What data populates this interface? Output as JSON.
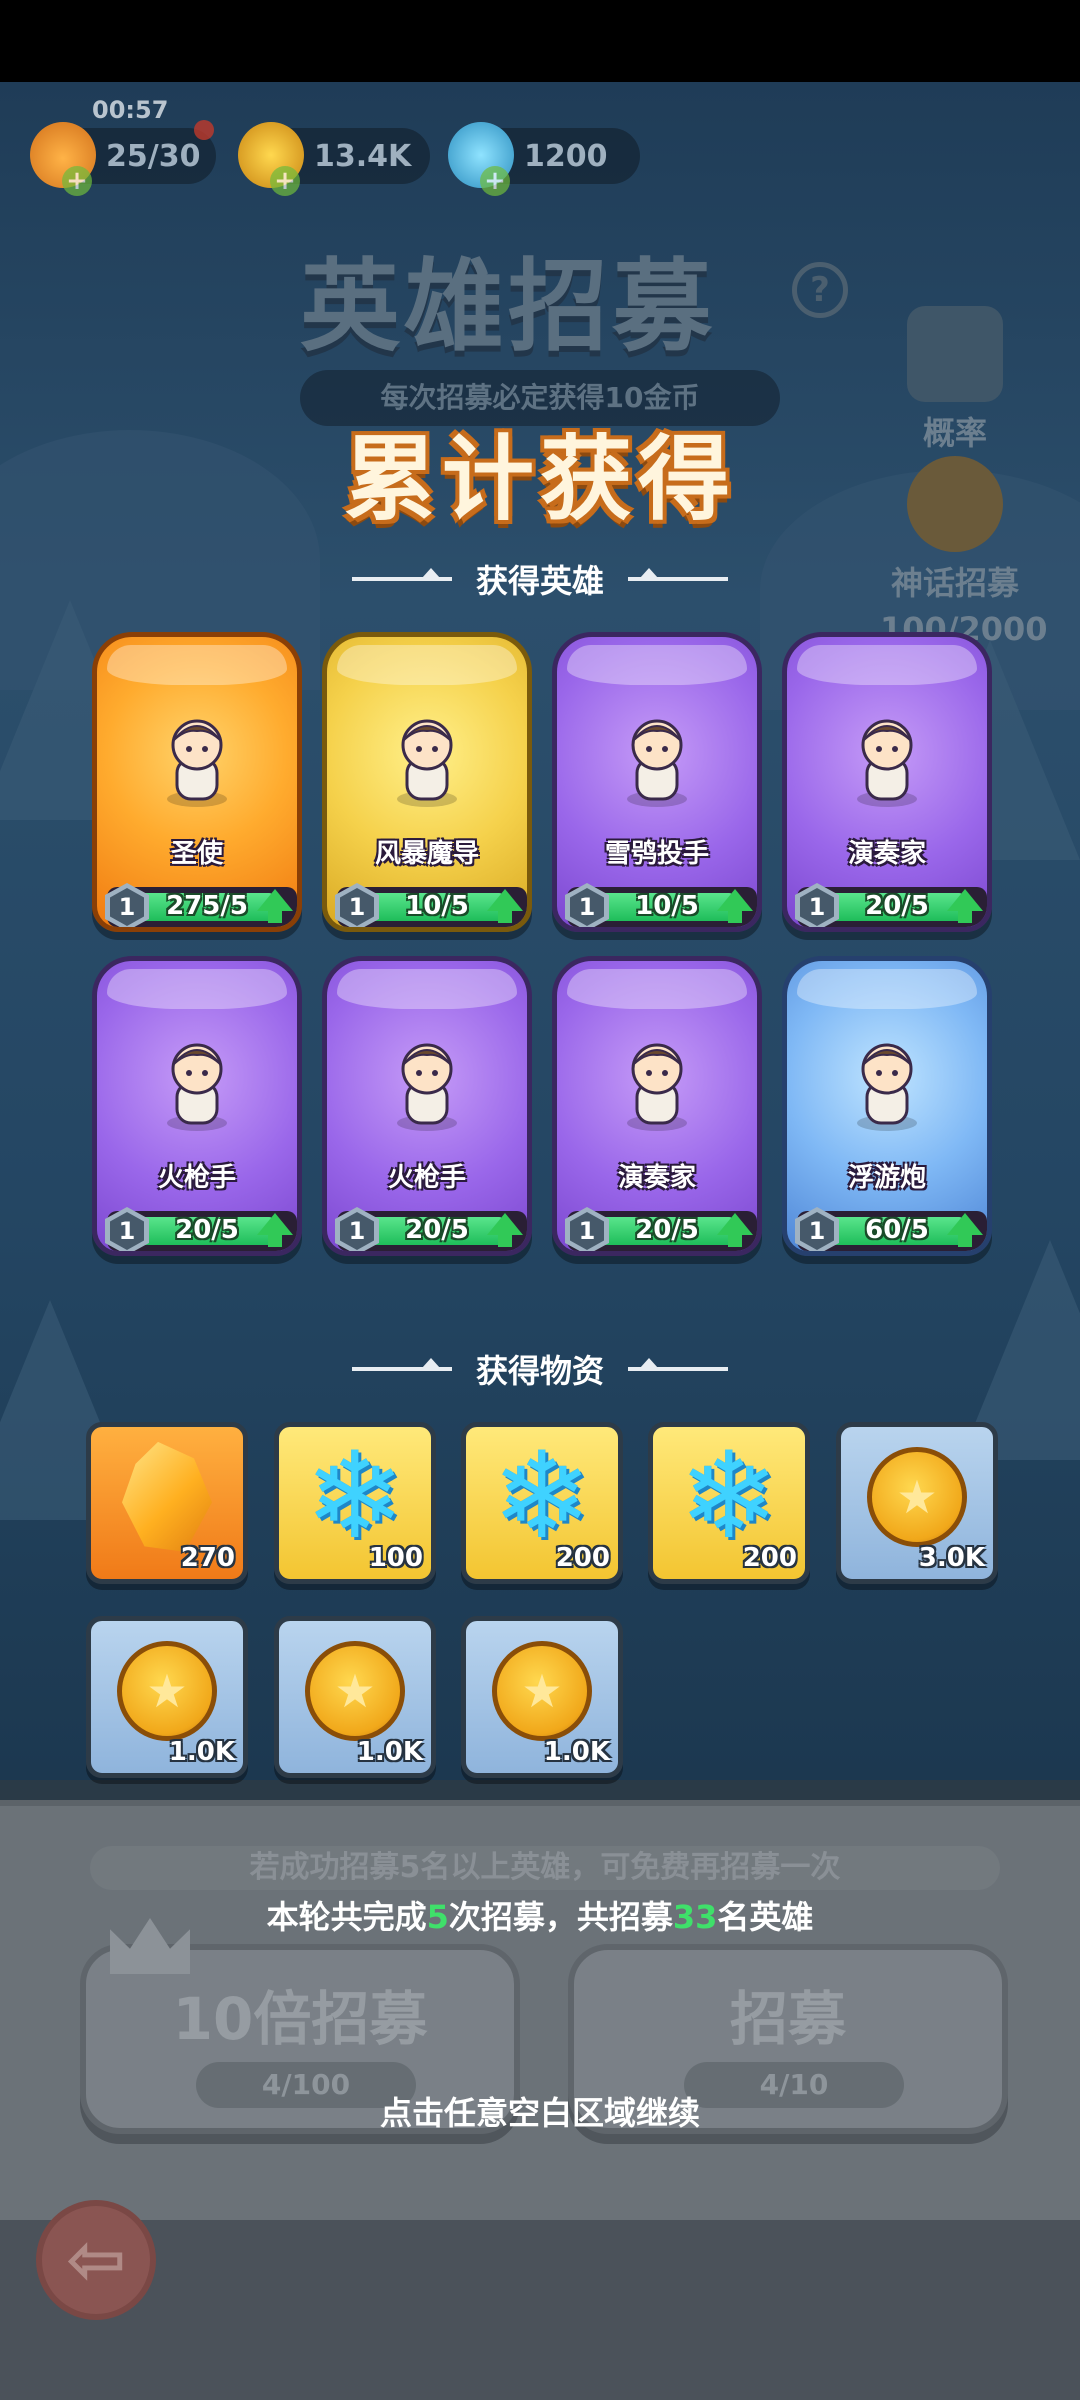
{
  "status": {
    "timer": "00:57"
  },
  "resources": [
    {
      "icon": "energy-icon",
      "value": "25/30"
    },
    {
      "icon": "gold-coin-icon",
      "value": "13.4K"
    },
    {
      "icon": "snowflake-gem-icon",
      "value": "1200"
    }
  ],
  "background": {
    "title": "英雄招募",
    "subtitle": "每次招募必定获得10金币",
    "help": "?",
    "rate_label": "概率",
    "myth_label": "神话招募",
    "myth_progress": "100/2000"
  },
  "popup": {
    "headline": "累计获得",
    "heroes_section": "获得英雄",
    "items_section": "获得物资",
    "heroes": [
      {
        "name": "圣使",
        "level": "1",
        "count": "275/5",
        "rarity": "orange",
        "icon": "angel-hero-icon",
        "progress": 1.0
      },
      {
        "name": "风暴魔导",
        "level": "1",
        "count": "10/5",
        "rarity": "gold",
        "icon": "storm-wizard-hero-icon",
        "progress": 1.0
      },
      {
        "name": "雪鸮投手",
        "level": "1",
        "count": "10/5",
        "rarity": "purple",
        "icon": "snow-owl-hero-icon",
        "progress": 1.0
      },
      {
        "name": "演奏家",
        "level": "1",
        "count": "20/5",
        "rarity": "purple",
        "icon": "bard-hero-icon",
        "progress": 1.0
      },
      {
        "name": "火枪手",
        "level": "1",
        "count": "20/5",
        "rarity": "purple",
        "icon": "musketeer-hero-icon",
        "progress": 1.0
      },
      {
        "name": "火枪手",
        "level": "1",
        "count": "20/5",
        "rarity": "purple",
        "icon": "musketeer-hero-icon",
        "progress": 1.0
      },
      {
        "name": "演奏家",
        "level": "1",
        "count": "20/5",
        "rarity": "purple",
        "icon": "bard-hero-icon",
        "progress": 1.0
      },
      {
        "name": "浮游炮",
        "level": "1",
        "count": "60/5",
        "rarity": "blue",
        "icon": "floating-cannon-hero-icon",
        "progress": 1.0
      }
    ],
    "items": [
      {
        "qty": "270",
        "bg": "orange",
        "icon": "amber-crystal-icon"
      },
      {
        "qty": "100",
        "bg": "gold",
        "icon": "snowflake-gem-icon"
      },
      {
        "qty": "200",
        "bg": "gold",
        "icon": "snowflake-gem-icon"
      },
      {
        "qty": "200",
        "bg": "gold",
        "icon": "snowflake-gem-icon"
      },
      {
        "qty": "3.0K",
        "bg": "blue",
        "icon": "gold-coin-icon"
      },
      {
        "qty": "1.0K",
        "bg": "blue",
        "icon": "gold-coin-icon"
      },
      {
        "qty": "1.0K",
        "bg": "blue",
        "icon": "gold-coin-icon"
      },
      {
        "qty": "1.0K",
        "bg": "blue",
        "icon": "gold-coin-icon"
      }
    ]
  },
  "footer": {
    "dim_note": "若成功招募5名以上英雄，可免费再招募一次",
    "summary_pre": "本轮共完成",
    "summary_rounds": "5",
    "summary_mid": "次招募，共招募",
    "summary_heroes": "33",
    "summary_post": "名英雄",
    "ten_recruit_label": "10倍招募",
    "ten_recruit_keys": "4/100",
    "recruit_label": "招募",
    "recruit_keys": "4/10",
    "continue_hint": "点击任意空白区域继续",
    "back": "⇦"
  },
  "colors": {
    "orange": "#f39a25",
    "gold": "#f2cf49",
    "purple": "#9a67ea",
    "blue": "#7fb8f5",
    "progress_green": "#31c957",
    "highlight_green": "#3fe06a",
    "headline_outline": "#c76c1b"
  }
}
